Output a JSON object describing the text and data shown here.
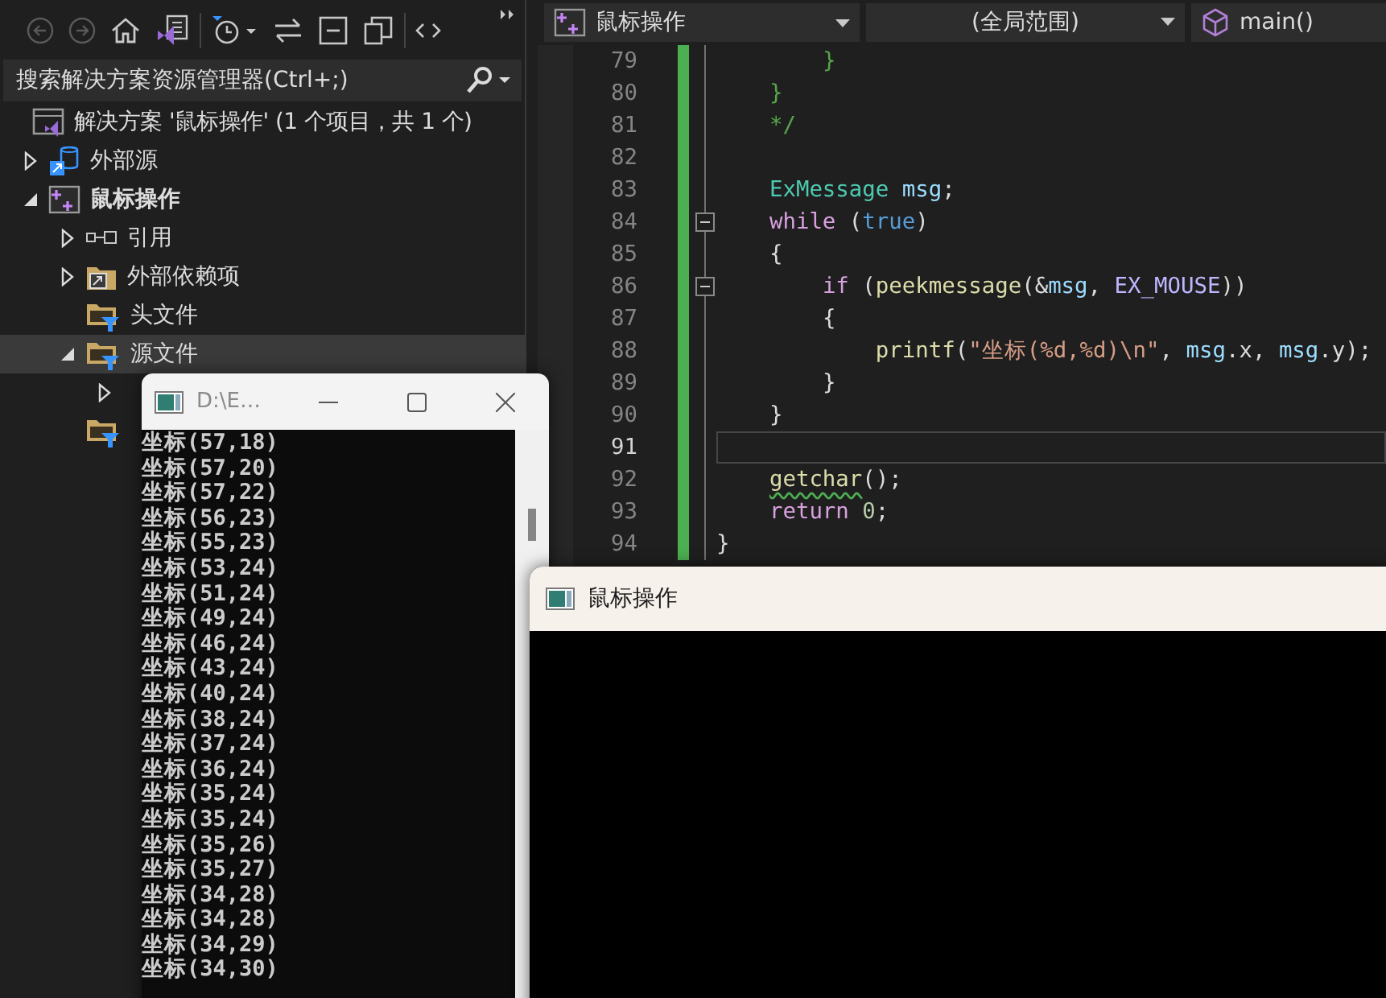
{
  "solution_explorer": {
    "toolbar_groups": [
      [
        {
          "kind": "back",
          "disabled": true
        },
        {
          "kind": "forward",
          "disabled": true
        },
        {
          "kind": "home",
          "disabled": false
        },
        {
          "kind": "switch-view",
          "disabled": false
        }
      ],
      [
        {
          "kind": "history",
          "disabled": false
        },
        {
          "kind": "sync",
          "disabled": false
        },
        {
          "kind": "collapse",
          "disabled": false
        },
        {
          "kind": "show-all",
          "disabled": false
        }
      ],
      [
        {
          "kind": "code",
          "disabled": false
        }
      ]
    ],
    "search": {
      "placeholder": "搜索解决方案资源管理器(Ctrl+;)"
    },
    "tree": [
      {
        "kind": "solution",
        "label": "解决方案 '鼠标操作' (1 个项目，共 1 个)",
        "selected": false,
        "children": [
          {
            "kind": "external-sources",
            "label": "外部源",
            "expanded": false,
            "selected": false
          },
          {
            "kind": "project",
            "label": "鼠标操作",
            "expanded": true,
            "selected": false,
            "children": [
              {
                "kind": "references",
                "label": "引用",
                "expanded": false,
                "selected": false
              },
              {
                "kind": "external-dependencies",
                "label": "外部依赖项",
                "expanded": false,
                "selected": false
              },
              {
                "kind": "filter-folder",
                "label": "头文件",
                "selected": false
              },
              {
                "kind": "filter-folder",
                "label": "源文件",
                "expanded": true,
                "selected": true,
                "children": [
                  {
                    "expanded": false,
                    "selected": false
                  }
                ]
              },
              {
                "kind": "filter-folder",
                "selected": false
              }
            ]
          }
        ]
      }
    ]
  },
  "editor": {
    "project_dropdown": "鼠标操作",
    "scope_dropdown": "(全局范围)",
    "member_dropdown": "main()",
    "lines": [
      {
        "number": "79",
        "current": false,
        "modified": true,
        "foldable": false,
        "tokens": [
          {
            "kind": "comment",
            "text": "        }"
          }
        ]
      },
      {
        "number": "80",
        "current": false,
        "modified": true,
        "foldable": false,
        "tokens": [
          {
            "kind": "comment",
            "text": "    }"
          }
        ]
      },
      {
        "number": "81",
        "current": false,
        "modified": true,
        "foldable": false,
        "tokens": [
          {
            "kind": "comment",
            "text": "    */"
          }
        ]
      },
      {
        "number": "82",
        "current": false,
        "modified": true,
        "foldable": false
      },
      {
        "number": "83",
        "current": false,
        "modified": true,
        "foldable": false,
        "tokens": [
          {
            "kind": "type",
            "text": "    ExMessage"
          },
          {
            "kind": "var",
            "text": " msg"
          },
          {
            "kind": "plain",
            "text": ";"
          }
        ]
      },
      {
        "number": "84",
        "current": false,
        "modified": true,
        "foldable": true,
        "tokens": [
          {
            "kind": "keyword",
            "text": "    while"
          },
          {
            "kind": "plain",
            "text": " ("
          },
          {
            "kind": "bool",
            "text": "true"
          },
          {
            "kind": "plain",
            "text": ")"
          }
        ]
      },
      {
        "number": "85",
        "current": false,
        "modified": true,
        "foldable": false,
        "tokens": [
          {
            "kind": "plain",
            "text": "    {"
          }
        ]
      },
      {
        "number": "86",
        "current": false,
        "modified": true,
        "foldable": true,
        "tokens": [
          {
            "kind": "keyword",
            "text": "        if"
          },
          {
            "kind": "plain",
            "text": " ("
          },
          {
            "kind": "func",
            "text": "peekmessage"
          },
          {
            "kind": "plain",
            "text": "(&"
          },
          {
            "kind": "var",
            "text": "msg"
          },
          {
            "kind": "plain",
            "text": ", "
          },
          {
            "kind": "macro",
            "text": "EX_MOUSE"
          },
          {
            "kind": "plain",
            "text": "))"
          }
        ]
      },
      {
        "number": "87",
        "current": false,
        "modified": true,
        "foldable": false,
        "tokens": [
          {
            "kind": "plain",
            "text": "        {"
          }
        ]
      },
      {
        "number": "88",
        "current": false,
        "modified": true,
        "foldable": false,
        "tokens": [
          {
            "kind": "func",
            "text": "            printf"
          },
          {
            "kind": "plain",
            "text": "("
          },
          {
            "kind": "string",
            "text": "\"坐标(%d,%d)\\n\""
          },
          {
            "kind": "plain",
            "text": ", "
          },
          {
            "kind": "var",
            "text": "msg"
          },
          {
            "kind": "plain",
            "text": ".x, "
          },
          {
            "kind": "var",
            "text": "msg"
          },
          {
            "kind": "plain",
            "text": ".y);"
          }
        ]
      },
      {
        "number": "89",
        "current": false,
        "modified": true,
        "foldable": false,
        "tokens": [
          {
            "kind": "plain",
            "text": "        }"
          }
        ]
      },
      {
        "number": "90",
        "current": false,
        "modified": true,
        "foldable": false,
        "tokens": [
          {
            "kind": "plain",
            "text": "    }"
          }
        ]
      },
      {
        "number": "91",
        "current": true,
        "modified": true,
        "foldable": false
      },
      {
        "number": "92",
        "current": false,
        "modified": true,
        "foldable": false,
        "tokens": [
          {
            "kind": "func",
            "text": "    getchar",
            "warning": true
          },
          {
            "kind": "plain",
            "text": "();"
          }
        ]
      },
      {
        "number": "93",
        "current": false,
        "modified": true,
        "foldable": false,
        "tokens": [
          {
            "kind": "keyword",
            "text": "    return"
          },
          {
            "kind": "number",
            "text": " 0"
          },
          {
            "kind": "plain",
            "text": ";"
          }
        ]
      },
      {
        "number": "94",
        "current": false,
        "modified": true,
        "foldable": false,
        "tokens": [
          {
            "kind": "plain",
            "text": "}"
          }
        ]
      }
    ]
  },
  "console_window": {
    "title": "D:\\E…",
    "lines": [
      "坐标(57,18)",
      "坐标(57,20)",
      "坐标(57,22)",
      "坐标(56,23)",
      "坐标(55,23)",
      "坐标(53,24)",
      "坐标(51,24)",
      "坐标(49,24)",
      "坐标(46,24)",
      "坐标(43,24)",
      "坐标(40,24)",
      "坐标(38,24)",
      "坐标(37,24)",
      "坐标(36,24)",
      "坐标(35,24)",
      "坐标(35,24)",
      "坐标(35,26)",
      "坐标(35,27)",
      "坐标(34,28)",
      "坐标(34,28)",
      "坐标(34,29)",
      "坐标(34,30)"
    ]
  },
  "graphics_window": {
    "title": "鼠标操作"
  }
}
